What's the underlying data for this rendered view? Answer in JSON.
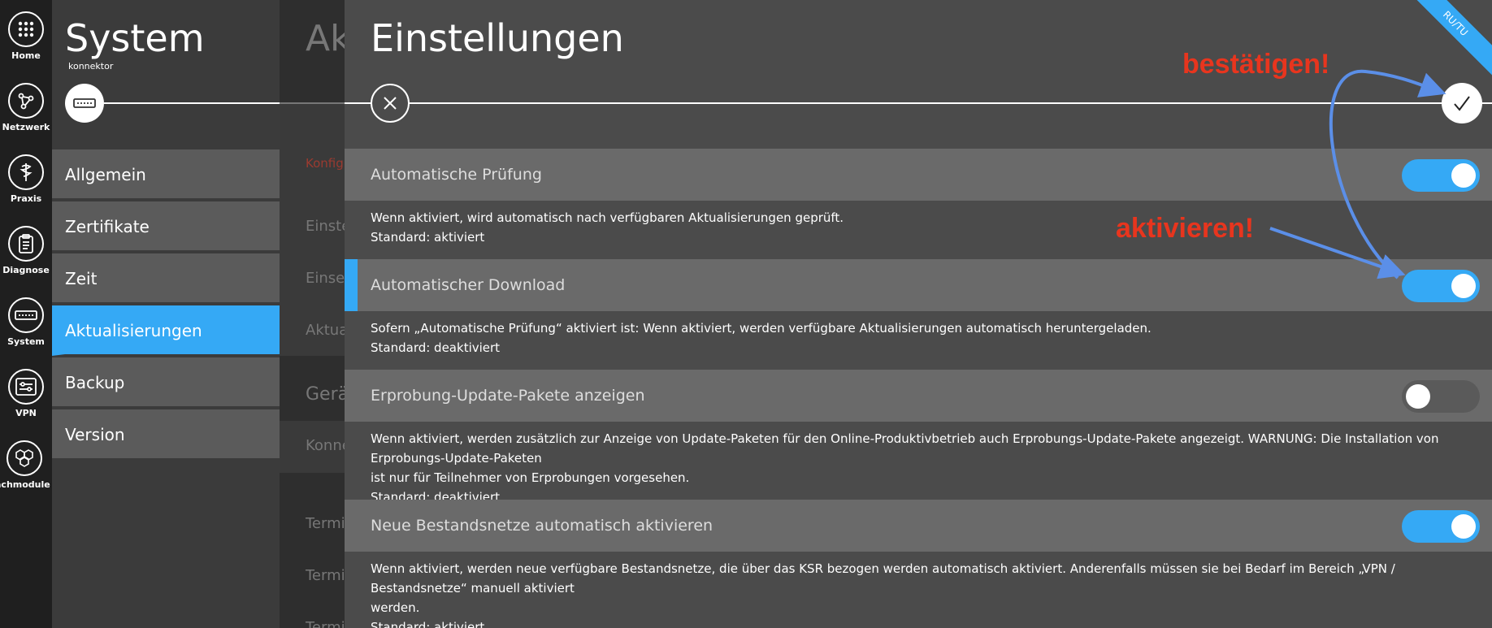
{
  "rail": {
    "items": [
      {
        "label": "Home",
        "icon": "grid-icon"
      },
      {
        "label": "Netzwerk",
        "icon": "network-icon"
      },
      {
        "label": "Praxis",
        "icon": "caduceus-icon"
      },
      {
        "label": "Diagnose",
        "icon": "clipboard-icon"
      },
      {
        "label": "System",
        "icon": "connector-device-icon"
      },
      {
        "label": "VPN",
        "icon": "vpn-sliders-icon"
      },
      {
        "label": "achmodule",
        "icon": "hexagons-icon"
      }
    ]
  },
  "sysnav": {
    "title": "System",
    "subtitle": "konnektor",
    "items": [
      "Allgemein",
      "Zertifikate",
      "Zeit",
      "Aktualisierungen",
      "Backup",
      "Version"
    ],
    "active_index": 3
  },
  "midcol": {
    "title": "Ak",
    "section": "Konfigu",
    "rows": [
      "Einste",
      "Einsel",
      "Aktua"
    ],
    "group": "Gerä",
    "group_row": "Konne",
    "terms": [
      "Termi",
      "Termi",
      "Termi"
    ]
  },
  "panel": {
    "title": "Einstellungen",
    "ribbon": "RU/TU",
    "settings": [
      {
        "label": "Automatische Prüfung",
        "enabled": true,
        "highlighted": false,
        "description": [
          "Wenn aktiviert, wird automatisch nach verfügbaren Aktualisierungen geprüft.",
          "Standard: aktiviert"
        ]
      },
      {
        "label": "Automatischer Download",
        "enabled": true,
        "highlighted": true,
        "description": [
          "Sofern „Automatische Prüfung“ aktiviert ist: Wenn aktiviert, werden verfügbare Aktualisierungen automatisch heruntergeladen.",
          "Standard: deaktiviert"
        ]
      },
      {
        "label": "Erprobung-Update-Pakete anzeigen",
        "enabled": false,
        "highlighted": false,
        "description": [
          "Wenn aktiviert, werden zusätzlich zur Anzeige von Update-Paketen für den Online-Produktivbetrieb auch Erprobungs-Update-Pakete angezeigt. WARNUNG: Die Installation von Erprobungs-Update-Paketen",
          "ist nur für Teilnehmer von Erprobungen vorgesehen.",
          "Standard: deaktiviert"
        ]
      },
      {
        "label": "Neue Bestandsnetze automatisch aktivieren",
        "enabled": true,
        "highlighted": false,
        "description": [
          "Wenn aktiviert, werden neue verfügbare Bestandsnetze, die über das KSR bezogen werden automatisch aktiviert. Anderenfalls müssen sie bei Bedarf im Bereich „VPN / Bestandsnetze“ manuell aktiviert",
          "werden.",
          "Standard: aktiviert"
        ]
      }
    ]
  },
  "annotations": {
    "confirm": "bestätigen!",
    "activate": "aktivieren!",
    "text_color": "#e8351e",
    "arrow_color": "#5b8fe8"
  },
  "colors": {
    "accent": "#35a9f5"
  }
}
